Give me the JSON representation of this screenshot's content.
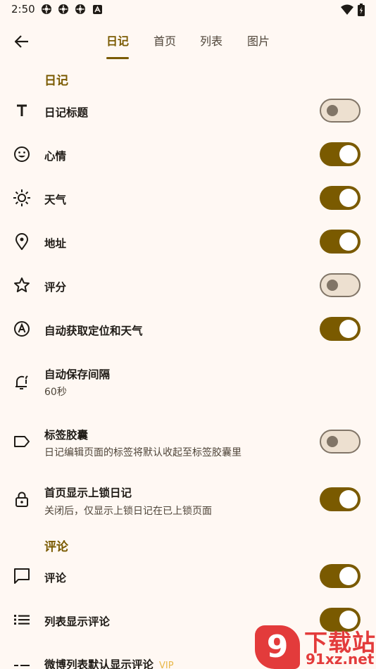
{
  "status_bar": {
    "time": "2:50",
    "notification_icons": [
      "gear-notification-icon",
      "gear-notification-icon",
      "gear-notification-icon",
      "text-a-notification-icon"
    ],
    "right_icons": [
      "wifi-icon",
      "battery-icon"
    ]
  },
  "app_bar": {
    "back_icon": "arrow-left-icon",
    "tabs": [
      {
        "label": "日记",
        "active": true
      },
      {
        "label": "首页",
        "active": false
      },
      {
        "label": "列表",
        "active": false
      },
      {
        "label": "图片",
        "active": false
      }
    ]
  },
  "sections": {
    "diary": {
      "header": "日记",
      "items": [
        {
          "icon": "title-t-icon",
          "title": "日记标题",
          "subtitle": "",
          "toggle": false
        },
        {
          "icon": "mood-smile-icon",
          "title": "心情",
          "subtitle": "",
          "toggle": true
        },
        {
          "icon": "weather-sun-icon",
          "title": "天气",
          "subtitle": "",
          "toggle": true
        },
        {
          "icon": "location-pin-icon",
          "title": "地址",
          "subtitle": "",
          "toggle": true
        },
        {
          "icon": "star-icon",
          "title": "评分",
          "subtitle": "",
          "toggle": false
        },
        {
          "icon": "auto-a-icon",
          "title": "自动获取定位和天气",
          "subtitle": "",
          "toggle": true
        },
        {
          "icon": "autosave-icon",
          "title": "自动保存间隔",
          "subtitle": "60秒",
          "toggle": null
        },
        {
          "icon": "label-tag-icon",
          "title": "标签胶囊",
          "subtitle": "日记编辑页面的标签将默认收起至标签胶囊里",
          "toggle": false
        },
        {
          "icon": "lock-icon",
          "title": "首页显示上锁日记",
          "subtitle": "关闭后，仅显示上锁日记在已上锁页面",
          "toggle": true
        }
      ]
    },
    "comments": {
      "header": "评论",
      "items": [
        {
          "icon": "comment-icon",
          "title": "评论",
          "subtitle": "",
          "toggle": true
        },
        {
          "icon": "list-icon",
          "title": "列表显示评论",
          "subtitle": "",
          "toggle": true
        },
        {
          "icon": "weibo-list-icon",
          "title": "微博列表默认显示评论",
          "badge": "VIP",
          "subtitle": "",
          "toggle": null
        }
      ]
    }
  },
  "watermark": {
    "badge": "9",
    "text": "下载站",
    "url": "91xz.net"
  },
  "colors": {
    "background": "#fff8f3",
    "accent": "#7a5a00",
    "switch_off_track": "#ede0d0",
    "switch_off_outline": "#817567",
    "vip": "#e8b84a",
    "watermark_red": "#e33b3b"
  }
}
